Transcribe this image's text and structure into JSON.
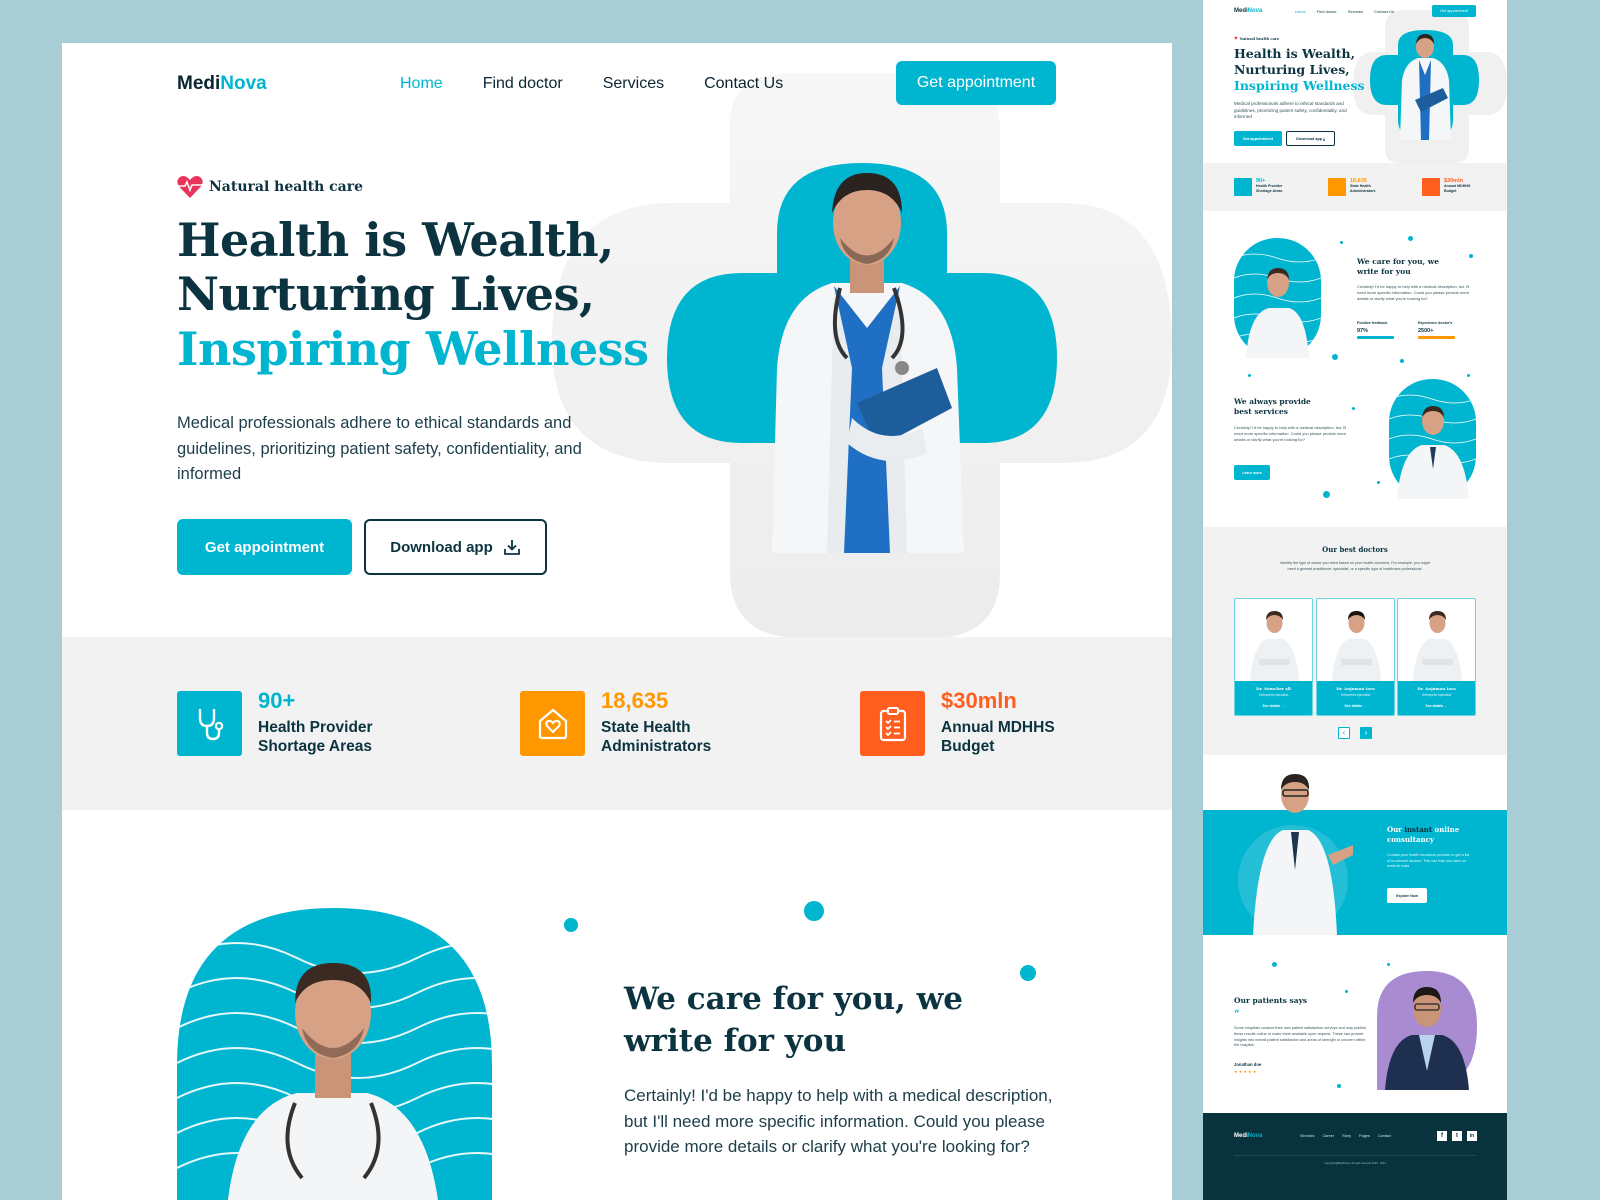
{
  "brand": {
    "prefix": "Medi",
    "suffix": "Nova"
  },
  "colors": {
    "primary": "#00b5d0",
    "dark": "#0b3340",
    "orange": "#ff9800",
    "red_orange": "#ff5e1f",
    "background": "#a9cdd4"
  },
  "nav": {
    "items": [
      {
        "label": "Home",
        "active": true
      },
      {
        "label": "Find doctor",
        "active": false
      },
      {
        "label": "Services",
        "active": false
      },
      {
        "label": "Contact Us",
        "active": false
      }
    ],
    "cta": "Get appointment"
  },
  "hero": {
    "tag": "Natural health care",
    "tag_icon": "heart-pulse-icon",
    "title_line1": "Health is Wealth,",
    "title_line2": "Nurturing Lives,",
    "title_line3": "Inspiring Wellness",
    "description": "Medical professionals adhere to ethical standards and guidelines, prioritizing patient safety, confidentiality, and informed",
    "primary_button": "Get appointment",
    "secondary_button": "Download app",
    "secondary_icon": "download-icon"
  },
  "stats": [
    {
      "value": "90+",
      "label_line1": "Health Provider",
      "label_line2": "Shortage Areas",
      "icon": "stethoscope-icon",
      "color": "#00b5d0"
    },
    {
      "value": "18,635",
      "label_line1": "State Health",
      "label_line2": "Administrators",
      "icon": "home-heart-icon",
      "color": "#ff9800"
    },
    {
      "value": "$30mln",
      "label_line1": "Annual MDHHS",
      "label_line2": "Budget",
      "icon": "clipboard-checklist-icon",
      "color": "#ff5e1f"
    }
  ],
  "care": {
    "title_line1": "We care for you, we",
    "title_line2": "write for you",
    "description": "Certainly! I'd be happy to help with a medical description, but I'll need more specific information. Could you please provide more details or clarify what you're looking for?"
  },
  "preview": {
    "care_stats": [
      {
        "label": "Positive feedback",
        "value": "97%",
        "color": "#00b5d0"
      },
      {
        "label": "Experience doctor's",
        "value": "2500+",
        "color": "#ff9800"
      }
    ],
    "services": {
      "title_line1": "We always provide",
      "title_line2": "best services",
      "description": "Certainly! I'd be happy to help with a medical description, but I'll need more specific information. Could you please provide more details or clarify what you're looking for?",
      "button": "Learn more"
    },
    "doctors": {
      "title": "Our best doctors",
      "description": "Identify the type of doctor you need based on your health concerns. For example, you might need a general practitioner, specialist, or a specific type of healthcare professional.",
      "cards": [
        {
          "name": "Dr. Somcher ali",
          "role": "Orthopedic specialist",
          "link": "See details →"
        },
        {
          "name": "Dr. Anjuman tara",
          "role": "Orthopedic specialist",
          "link": "See details →"
        },
        {
          "name": "Dr. Anjuman tara",
          "role": "Orthopedic specialist",
          "link": "See details →"
        }
      ],
      "prev": "‹",
      "next": "›"
    },
    "consultancy": {
      "title_a": "Our ",
      "title_b": "instant",
      "title_c": " online consultancy",
      "description": "Contact your health insurance provider to get a list of in-network doctors. This can help you save on medical costs",
      "button": "Explore Now"
    },
    "testimonial": {
      "title": "Our patients says",
      "quote_mark": "“",
      "text": "Some hospitals conduct their own patient satisfaction surveys and may publish these results online or make them available upon request. These can provide insights into overall patient satisfaction and areas of strength or concern within the hospital.",
      "author": "Jonathan doe",
      "rating": 5,
      "stars": "★ ★ ★ ★ ★"
    },
    "footer": {
      "links": [
        "Services",
        "Career",
        "Story",
        "Pages",
        "Contact"
      ],
      "social": [
        "f",
        "t",
        "in"
      ],
      "copyright": "Copyright@MediNova | All right reserved 2023 - 2024"
    }
  }
}
